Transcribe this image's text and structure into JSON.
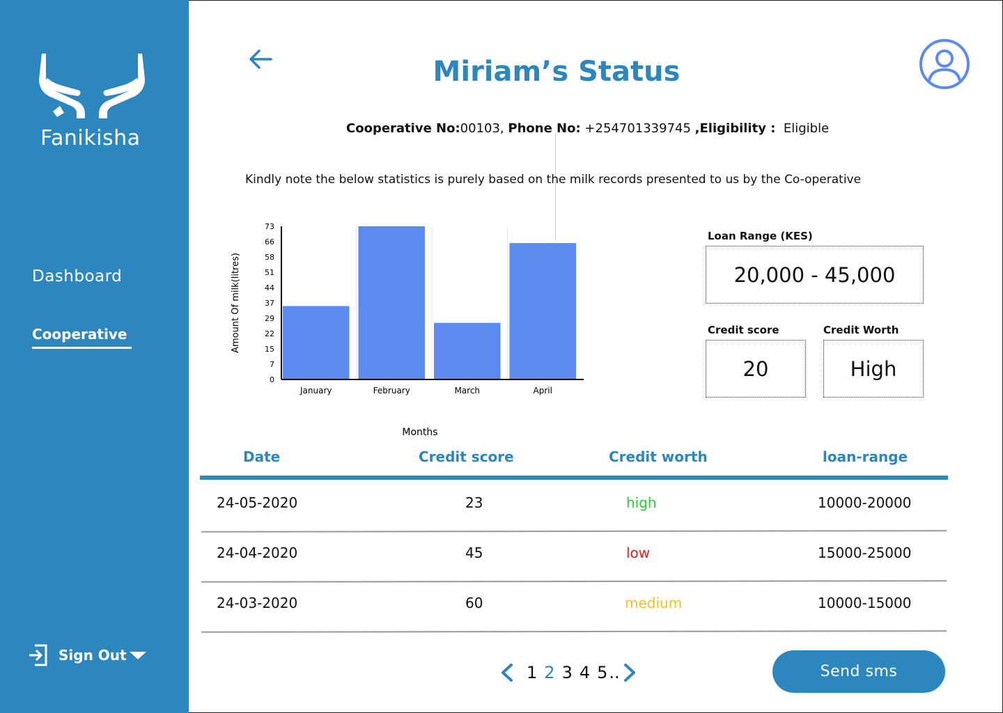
{
  "sidebar": {
    "brand": "Fanikisha",
    "items": [
      {
        "label": "Dashboard"
      },
      {
        "label": "Cooperative"
      }
    ],
    "sign_out": "Sign Out"
  },
  "header": {
    "title": "Miriam’s Status"
  },
  "info": {
    "coop_label": "Cooperative No:",
    "coop_value": "00103,",
    "phone_label": "Phone No:",
    "phone_value": "+254701339745",
    "elig_label": ",Eligibility :",
    "elig_value": "Eligible",
    "note": "Kindly note the below statistics is purely based on the milk records presented to us by the Co-operative"
  },
  "chart_data": {
    "type": "bar",
    "categories": [
      "January",
      "February",
      "March",
      "April"
    ],
    "values": [
      35,
      73,
      27,
      65
    ],
    "xlabel": "Months",
    "ylabel": "Amount Of milk(litres)",
    "ylim": [
      0,
      73
    ],
    "yticks": [
      "0",
      "7",
      "15",
      "22",
      "29",
      "37",
      "44",
      "51",
      "58",
      "66",
      "73"
    ],
    "bar_color": "#5b8bf0",
    "grid": false
  },
  "loan": {
    "range_label": "Loan Range (KES)",
    "range_value": "20,000 - 45,000",
    "score_label": "Credit score",
    "score_value": "20",
    "worth_label": "Credit Worth",
    "worth_value": "High"
  },
  "table": {
    "headers": [
      "Date",
      "Credit score",
      "Credit worth",
      "loan-range"
    ],
    "rows": [
      {
        "date": "24-05-2020",
        "score": "23",
        "worth": "high",
        "worth_color": "#22d02a",
        "range": "10000-20000"
      },
      {
        "date": "24-04-2020",
        "score": "45",
        "worth": "low",
        "worth_color": "#e0201c",
        "range": "15000-25000"
      },
      {
        "date": "24-03-2020",
        "score": "60",
        "worth": "medium",
        "worth_color": "#f2c11c",
        "range": "10000-15000"
      }
    ]
  },
  "pagination": {
    "pages": [
      "1",
      "2",
      "3",
      "4",
      "5"
    ],
    "current": "2",
    "more": ".."
  },
  "actions": {
    "send_sms": "Send sms"
  },
  "colors": {
    "accent": "#2b87be",
    "avatar": "#5b8bf0"
  }
}
